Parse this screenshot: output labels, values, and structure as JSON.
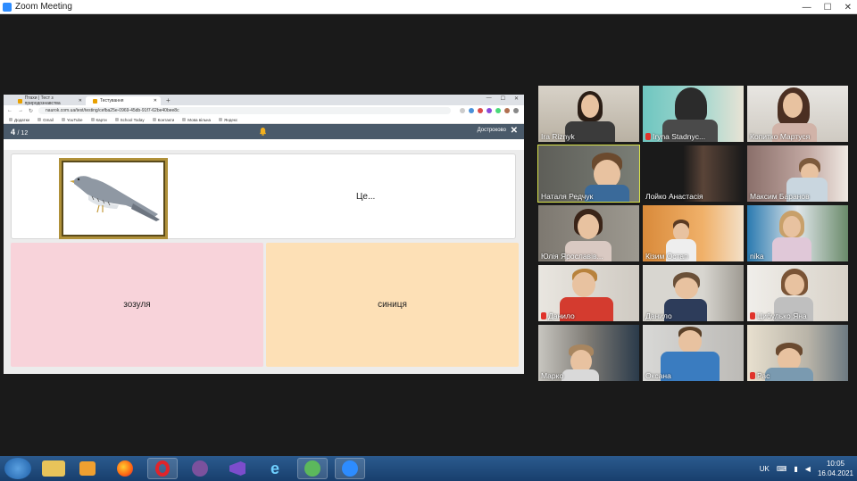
{
  "window": {
    "title": "Zoom Meeting"
  },
  "browser": {
    "tabs": [
      {
        "label": "Птахи | Тест з природознавства"
      },
      {
        "label": "Тестування"
      }
    ],
    "url": "naurok.com.ua/test/testing/cefba25e-0969-45db-91f7-62be40bee8c",
    "bookmarks": [
      "Додатки",
      "Gmail",
      "YouTube",
      "Карти",
      "School Today",
      "Контакти",
      "Мова вільна",
      "Яндекс"
    ]
  },
  "quiz": {
    "counter_current": "4",
    "counter_total": "/ 12",
    "finish_label": "Достроково",
    "question": "Це...",
    "answers": [
      "зозуля",
      "синиця"
    ]
  },
  "participants": [
    {
      "name": "Ira Riznyk",
      "muted": false
    },
    {
      "name": "Iryna Stadnyc...",
      "muted": true
    },
    {
      "name": "Копитко Мартуся",
      "muted": false
    },
    {
      "name": "Наталя Редчук",
      "muted": false
    },
    {
      "name": "Лойко Анастасія",
      "muted": false
    },
    {
      "name": "Максим Баранов",
      "muted": false
    },
    {
      "name": "Юлія Ярославів...",
      "muted": false
    },
    {
      "name": "Кізим   Остап",
      "muted": false
    },
    {
      "name": "nika",
      "muted": false
    },
    {
      "name": "Данило",
      "muted": true
    },
    {
      "name": "Данило",
      "muted": false
    },
    {
      "name": "Цибулько Яна",
      "muted": true
    },
    {
      "name": "Марко",
      "muted": false
    },
    {
      "name": "Оксана",
      "muted": false
    },
    {
      "name": "Рас",
      "muted": true
    }
  ],
  "taskbar": {
    "apps": [
      "explorer-icon",
      "media-player-icon",
      "firefox-icon",
      "opera-icon",
      "viber-icon",
      "visual-studio-icon",
      "ie-icon",
      "utorrent-icon",
      "zoom-icon"
    ],
    "language": "UK",
    "time": "10:05",
    "date": "16.04.2021"
  }
}
